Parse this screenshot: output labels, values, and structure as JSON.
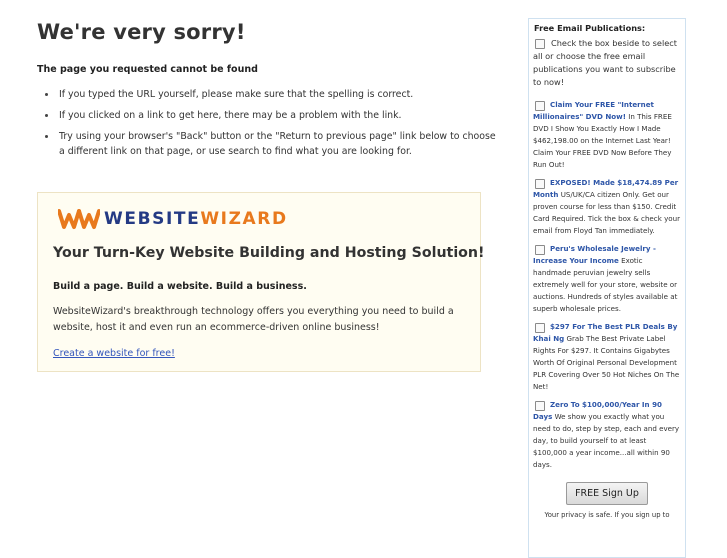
{
  "page": {
    "title": "We're very sorry!",
    "subtitle": "The page you requested cannot be found",
    "tips": [
      "If you typed the URL yourself, please make sure that the spelling is correct.",
      "If you clicked on a link to get here, there may be a problem with the link.",
      "Try using your browser's \"Back\" button or the \"Return to previous page\" link below to choose a different link on that page, or use search to find what you are looking for."
    ]
  },
  "promo": {
    "logo_word_1": "WEBSITE",
    "logo_word_2": "WIZARD",
    "logo_color_1": "#243a84",
    "logo_color_2": "#e8791d",
    "headline": "Your Turn-Key Website Building and Hosting Solution!",
    "tagline": "Build a page. Build a website. Build a business.",
    "body": "WebsiteWizard's breakthrough technology offers you everything you need to build a website, host it and even run an ecommerce-driven online business!",
    "link": "Create a website for free!"
  },
  "sidebar": {
    "title": "Free Email Publications:",
    "intro": "Check the box beside to select all or choose the free email publications you want to subscribe to now!",
    "items": [
      {
        "title": "Claim Your FREE \"Internet Millionaires\" DVD Now!",
        "desc": "In This FREE DVD I Show You Exactly How I Made $462,198.00 on the Internet Last Year! Claim Your FREE DVD Now Before They Run Out!"
      },
      {
        "title": "EXPOSED! Made $18,474.89 Per Month",
        "desc": "US/UK/CA citizen Only. Get our proven course for less than $150. Credit Card Required. Tick the box & check your email from Floyd Tan immediately."
      },
      {
        "title": "Peru's Wholesale Jewelry - Increase Your Income",
        "desc": "Exotic handmade peruvian jewelry sells extremely well for your store, website or auctions. Hundreds of styles available at superb wholesale prices."
      },
      {
        "title": "$297 For The Best PLR Deals By Khai Ng",
        "desc": "Grab The Best Private Label Rights For $297. It Contains Gigabytes Worth Of Original Personal Development PLR Covering Over 50 Hot Niches On The Net!"
      },
      {
        "title": "Zero To $100,000/Year In 90 Days",
        "desc": "We show you exactly what you need to do, step by step, each and every day, to build yourself to at least $100,000 a year income...all within 90 days."
      }
    ],
    "signup_button": "FREE Sign Up",
    "privacy": "Your privacy is safe. If you sign up to"
  }
}
